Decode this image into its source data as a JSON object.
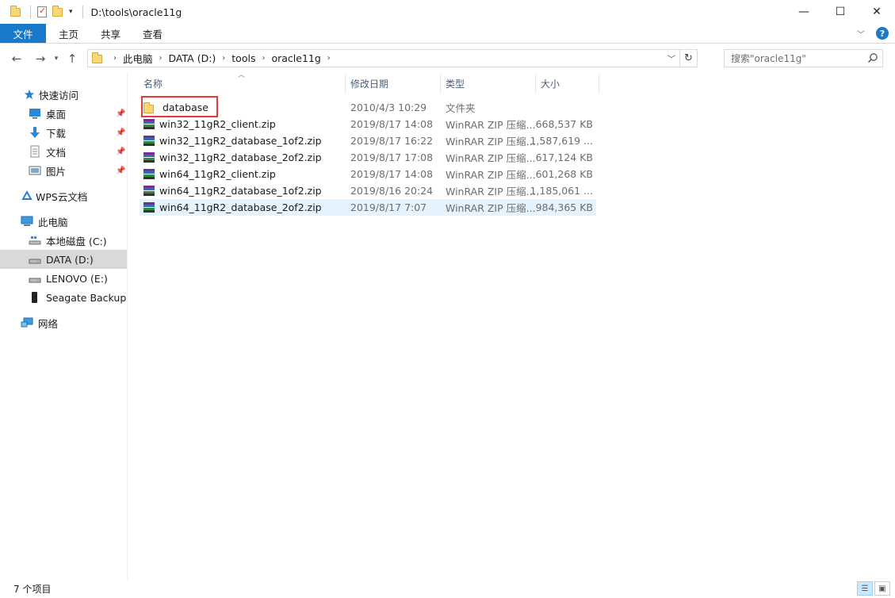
{
  "window": {
    "title": "D:\\tools\\oracle11g",
    "controls": {
      "minimize": "—",
      "maximize": "☐",
      "close": "✕"
    }
  },
  "ribbon": {
    "tabs": [
      "文件",
      "主页",
      "共享",
      "查看"
    ],
    "help": "?"
  },
  "address": {
    "breadcrumbs": [
      "此电脑",
      "DATA (D:)",
      "tools",
      "oracle11g"
    ]
  },
  "search": {
    "placeholder": "搜索\"oracle11g\""
  },
  "sidebar": {
    "items": [
      {
        "label": "快速访问",
        "icon": "star-icon"
      },
      {
        "label": "桌面",
        "icon": "desktop-icon",
        "pinned": true
      },
      {
        "label": "下载",
        "icon": "download-icon",
        "pinned": true
      },
      {
        "label": "文档",
        "icon": "document-icon",
        "pinned": true
      },
      {
        "label": "图片",
        "icon": "pictures-icon",
        "pinned": true
      },
      {
        "label": "WPS云文档",
        "icon": "wps-cloud-icon"
      },
      {
        "label": "此电脑",
        "icon": "computer-icon"
      },
      {
        "label": "本地磁盘 (C:)",
        "icon": "system-drive-icon"
      },
      {
        "label": "DATA (D:)",
        "icon": "drive-icon",
        "selected": true
      },
      {
        "label": "LENOVO (E:)",
        "icon": "drive-icon"
      },
      {
        "label": "Seagate Backup Plus Drive",
        "icon": "external-drive-icon"
      },
      {
        "label": "网络",
        "icon": "network-icon"
      }
    ]
  },
  "columns": [
    "名称",
    "修改日期",
    "类型",
    "大小"
  ],
  "files": [
    {
      "name": "database",
      "date": "2010/4/3 10:29",
      "type": "文件夹",
      "size": "",
      "icon": "folder-icon"
    },
    {
      "name": "win32_11gR2_client.zip",
      "date": "2019/8/17 14:08",
      "type": "WinRAR ZIP 压缩...",
      "size": "668,537 KB",
      "icon": "winrar-icon"
    },
    {
      "name": "win32_11gR2_database_1of2.zip",
      "date": "2019/8/17 16:22",
      "type": "WinRAR ZIP 压缩...",
      "size": "1,587,619 ...",
      "icon": "winrar-icon"
    },
    {
      "name": "win32_11gR2_database_2of2.zip",
      "date": "2019/8/17 17:08",
      "type": "WinRAR ZIP 压缩...",
      "size": "617,124 KB",
      "icon": "winrar-icon"
    },
    {
      "name": "win64_11gR2_client.zip",
      "date": "2019/8/17 14:08",
      "type": "WinRAR ZIP 压缩...",
      "size": "601,268 KB",
      "icon": "winrar-icon"
    },
    {
      "name": "win64_11gR2_database_1of2.zip",
      "date": "2019/8/16 20:24",
      "type": "WinRAR ZIP 压缩...",
      "size": "1,185,061 ...",
      "icon": "winrar-icon"
    },
    {
      "name": "win64_11gR2_database_2of2.zip",
      "date": "2019/8/17 7:07",
      "type": "WinRAR ZIP 压缩...",
      "size": "984,365 KB",
      "icon": "winrar-icon",
      "selected": true
    }
  ],
  "status": {
    "count": "7 个项目"
  },
  "colors": {
    "accent": "#1979ca",
    "selected_row": "#e5f3ff",
    "highlight_box": "#e53a3a",
    "folder": "#f8d775"
  }
}
